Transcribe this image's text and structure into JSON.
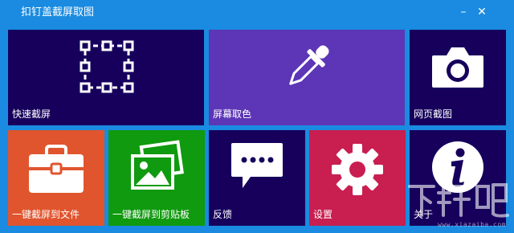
{
  "window": {
    "title": "扣钉盖截屏取图",
    "minimize_glyph": "–",
    "close_glyph": "✕"
  },
  "tiles": [
    {
      "label": "快速截屏",
      "icon": "selection-box-icon",
      "color": "#16005c"
    },
    {
      "label": "屏幕取色",
      "icon": "eyedropper-icon",
      "color": "#5c36b6"
    },
    {
      "label": "网页截图",
      "icon": "camera-icon",
      "color": "#16005c"
    },
    {
      "label": "一键截屏到文件",
      "icon": "briefcase-icon",
      "color": "#e0552e"
    },
    {
      "label": "一键截屏到剪贴板",
      "icon": "pictures-icon",
      "color": "#109a0f"
    },
    {
      "label": "反馈",
      "icon": "speech-bubble-icon",
      "color": "#16005c"
    },
    {
      "label": "设置",
      "icon": "gear-icon",
      "color": "#c81e50"
    },
    {
      "label": "关于",
      "icon": "info-icon",
      "color": "#16005c"
    }
  ],
  "watermark": {
    "text": "下载吧",
    "sub": "www.xiazaiba.com"
  }
}
